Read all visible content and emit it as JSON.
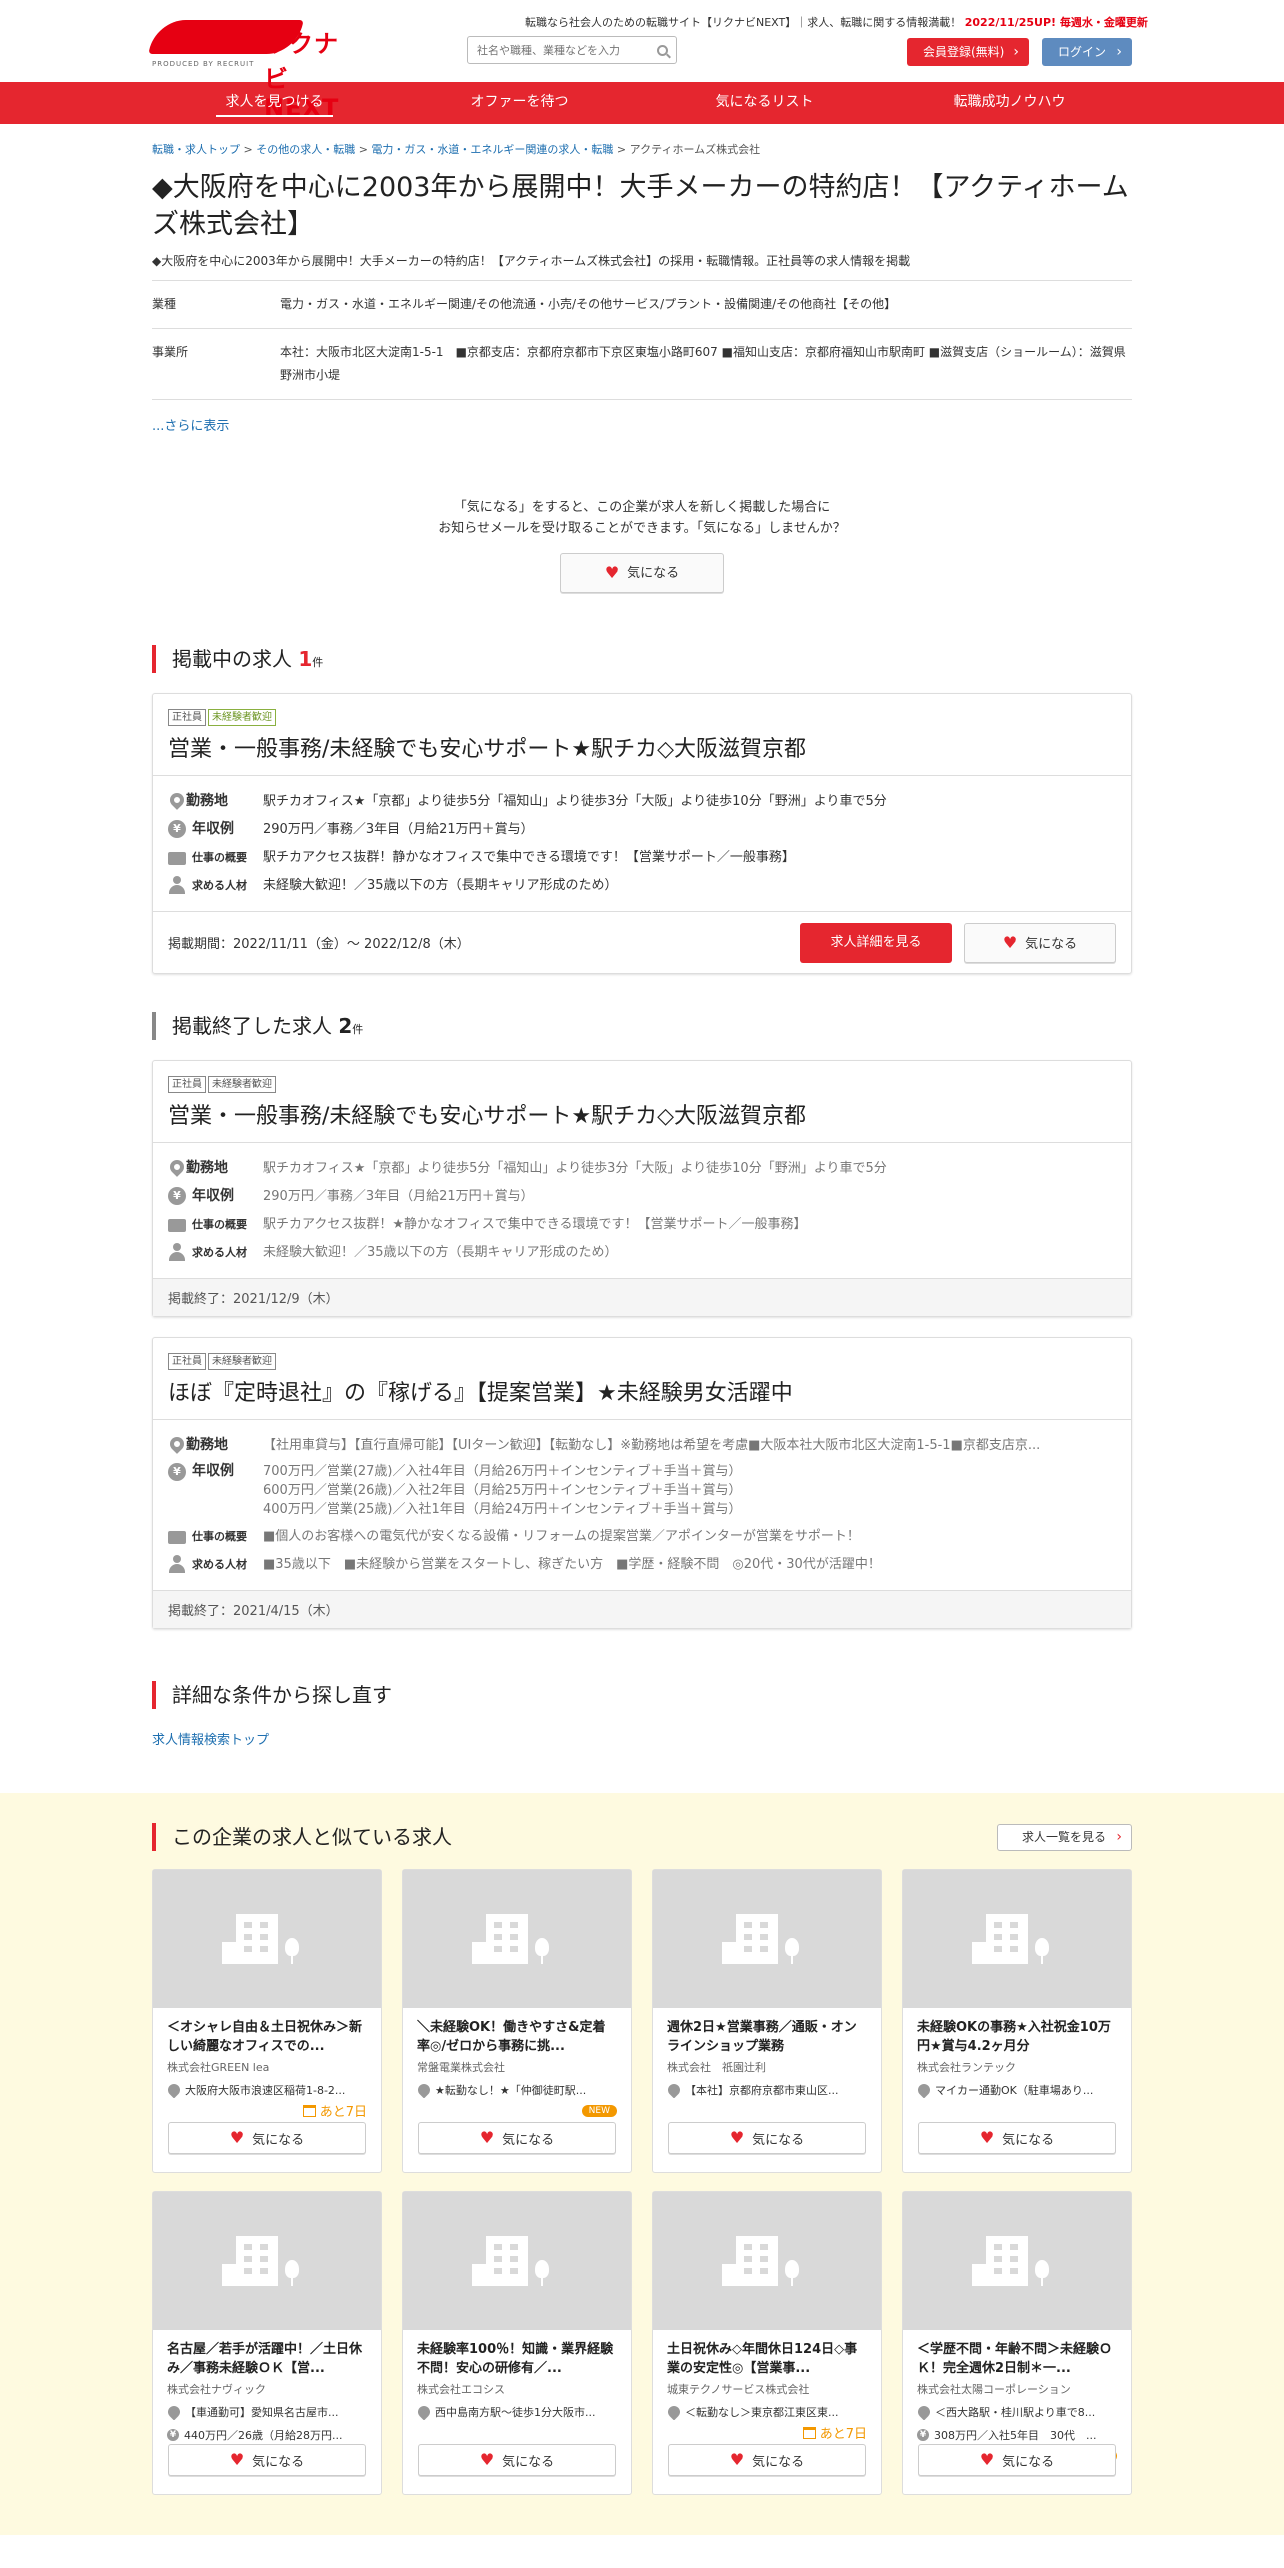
{
  "header": {
    "logo_text": "リクナビNEXT",
    "logo_sub": "PRODUCED BY RECRUIT",
    "tagline": "転職なら社会人のための転職サイト【リクナビNEXT】｜求人、転職に関する情報満載！",
    "update": "2022/11/25UP! 毎週水・金曜更新",
    "search_placeholder": "社名や職種、業種などを入力",
    "register": "会員登録(無料)",
    "login": "ログイン"
  },
  "nav": [
    "求人を見つける",
    "オファーを待つ",
    "気になるリスト",
    "転職成功ノウハウ"
  ],
  "breadcrumb": [
    "転職・求人トップ",
    "その他の求人・転職",
    "電力・ガス・水道・エネルギー関連の求人・転職",
    "アクティホームズ株式会社"
  ],
  "title": "◆大阪府を中心に2003年から展開中！大手メーカーの特約店！【アクティホームズ株式会社】",
  "lead": "◆大阪府を中心に2003年から展開中！大手メーカーの特約店！【アクティホームズ株式会社】の採用・転職情報。正社員等の求人情報を掲載",
  "info": [
    {
      "k": "業種",
      "v": "電力・ガス・水道・エネルギー関連/その他流通・小売/その他サービス/プラント・設備関連/その他商社【その他】"
    },
    {
      "k": "事業所",
      "v": "本社：大阪市北区大淀南1-5-1　■京都支店：京都府京都市下京区東塩小路町607 ■福知山支店：京都府福知山市駅南町 ■滋賀支店（ショールーム）：滋賀県野洲市小堤"
    }
  ],
  "more": "...さらに表示",
  "follow": {
    "text1": "「気になる」をすると、この企業が求人を新しく掲載した場合に",
    "text2": "お知らせメールを受け取ることができます。「気になる」しませんか？",
    "button": "気になる"
  },
  "active": {
    "heading": "掲載中の求人",
    "count": "1",
    "unit": "件",
    "jobs": [
      {
        "tags": [
          "正社員",
          "未経験者歓迎"
        ],
        "title": "営業・一般事務/未経験でも安心サポート★駅チカ◇大阪滋賀京都",
        "location_label": "勤務地",
        "location": "駅チカオフィス★「京都」より徒歩5分「福知山」より徒歩3分「大阪」より徒歩10分「野洲」より車で5分",
        "salary_label": "年収例",
        "salary": [
          "290万円／事務／3年目（月給21万円＋賞与）"
        ],
        "summary_label": "仕事の概要",
        "summary": "駅チカアクセス抜群！静かなオフィスで集中できる環境です！【営業サポート／一般事務】",
        "req_label": "求める人材",
        "req": "未経験大歓迎！／35歳以下の方（長期キャリア形成のため）",
        "period": "掲載期間：2022/11/11（金）～ 2022/12/8（木）",
        "detail_button": "求人詳細を見る",
        "fav_button": "気になる"
      }
    ]
  },
  "ended": {
    "heading": "掲載終了した求人",
    "count": "2",
    "unit": "件",
    "jobs": [
      {
        "tags": [
          "正社員",
          "未経験者歓迎"
        ],
        "title": "営業・一般事務/未経験でも安心サポート★駅チカ◇大阪滋賀京都",
        "location_label": "勤務地",
        "location": "駅チカオフィス★「京都」より徒歩5分「福知山」より徒歩3分「大阪」より徒歩10分「野洲」より車で5分",
        "salary_label": "年収例",
        "salary": [
          "290万円／事務／3年目（月給21万円＋賞与）"
        ],
        "summary_label": "仕事の概要",
        "summary": "駅チカアクセス抜群！★静かなオフィスで集中できる環境です！【営業サポート／一般事務】",
        "req_label": "求める人材",
        "req": "未経験大歓迎！／35歳以下の方（長期キャリア形成のため）",
        "period": "掲載終了：2021/12/9（木）"
      },
      {
        "tags": [
          "正社員",
          "未経験者歓迎"
        ],
        "title": "ほぼ『定時退社』の『稼げる』【提案営業】★未経験男女活躍中",
        "location_label": "勤務地",
        "location": "【社用車貸与】【直行直帰可能】【UIターン歓迎】【転勤なし】※勤務地は希望を考慮■大阪本社大阪市北区大淀南1-5-1■京都支店京...",
        "salary_label": "年収例",
        "salary": [
          "700万円／営業(27歳)／入社4年目（月給26万円＋インセンティブ＋手当＋賞与）",
          "600万円／営業(26歳)／入社2年目（月給25万円＋インセンティブ＋手当＋賞与）",
          "400万円／営業(25歳)／入社1年目（月給24万円＋インセンティブ＋手当＋賞与）"
        ],
        "summary_label": "仕事の概要",
        "summary": "■個人のお客様への電気代が安くなる設備・リフォームの提案営業／アポインターが営業をサポート！",
        "req_label": "求める人材",
        "req": "■35歳以下　■未経験から営業をスタートし、稼ぎたい方　■学歴・経験不問　◎20代・30代が活躍中！",
        "period": "掲載終了：2021/4/15（木）"
      }
    ]
  },
  "research": {
    "heading": "詳細な条件から探し直す",
    "link": "求人情報検索トップ"
  },
  "similar": {
    "heading": "この企業の求人と似ている求人",
    "list_button": "求人一覧を見る",
    "fav_button": "気になる",
    "cards": [
      {
        "title": "＜オシャレ自由＆土日祝休み＞新しい綺麗なオフィスでの...",
        "company": "株式会社GREEN lea",
        "loc": "大阪府大阪市浪速区稲荷1-8-2...",
        "salary": "",
        "badge": "あと7日",
        "badge_type": "days"
      },
      {
        "title": "＼未経験OK！働きやすさ&定着率◎/ゼロから事務に挑...",
        "company": "常盤電業株式会社",
        "loc": "★転勤なし！★「仲御徒町駅...",
        "salary": "",
        "badge": "NEW",
        "badge_type": "new"
      },
      {
        "title": "週休2日★営業事務／通販・オンラインショップ業務",
        "company": "株式会社　祇園辻利",
        "loc": "【本社】京都府京都市東山区...",
        "salary": "",
        "badge": "",
        "badge_type": ""
      },
      {
        "title": "未経験OKの事務★入社祝金10万円★賞与4.2ヶ月分",
        "company": "株式会社ランテック",
        "loc": "マイカー通勤OK（駐車場あり...",
        "salary": "",
        "badge": "",
        "badge_type": ""
      },
      {
        "title": "名古屋／若手が活躍中！／土日休み／事務未経験ＯＫ【営...",
        "company": "株式会社ナヴィック",
        "loc": "【車通勤可】愛知県名古屋市...",
        "salary": "440万円／26歳（月給28万円...",
        "badge": "",
        "badge_type": ""
      },
      {
        "title": "未経験率100％！知識・業界経験不問！安心の研修有／...",
        "company": "株式会社エコシス",
        "loc": "西中島南方駅～徒歩1分大阪市...",
        "salary": "",
        "badge": "",
        "badge_type": ""
      },
      {
        "title": "土日祝休み◇年間休日124日◇事業の安定性◎【営業事...",
        "company": "城東テクノサービス株式会社",
        "loc": "＜転勤なし＞東京都江東区東...",
        "salary": "",
        "badge": "あと7日",
        "badge_type": "days"
      },
      {
        "title": "＜学歴不問・年齢不問＞未経験ＯＫ！完全週休2日制＊一...",
        "company": "株式会社太陽コーポレーション",
        "loc": "＜西大路駅・桂川駅より車で8...",
        "salary": "308万円／入社5年目　30代　...",
        "badge": "NEW",
        "badge_type": "new"
      }
    ]
  },
  "colors": {
    "brand": "#e5262f",
    "badge": "#f39800",
    "similar_bg": "#fefae0"
  }
}
